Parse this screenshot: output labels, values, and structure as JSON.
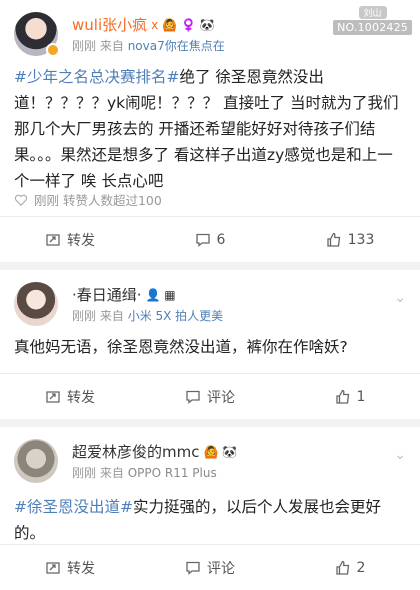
{
  "watermark": {
    "line1": "刘山",
    "line2": "NO.1002425"
  },
  "posts": [
    {
      "user": {
        "name": "wuli张小疯",
        "suffix": "x",
        "badges": "🙆 ♀️ 🐼"
      },
      "meta": {
        "time": "刚刚",
        "source_prefix": "来自",
        "source": "nova7你在焦点在"
      },
      "tag": "#少年之名总决赛排名#",
      "body": "绝了 徐圣恩竟然没出道！？？？？yk闹呢！？？？ 直接吐了 当时就为了我们那几个大厂男孩去的 开播还希望能好好对待孩子们结果。。。果然还是想多了 看这样子出道zy感觉也是和上一个一样了 唉 长点心吧",
      "stats": "刚刚 转赞人数超过100",
      "actions": {
        "repost": "转发",
        "comment": "6",
        "like": "133"
      }
    },
    {
      "user": {
        "name": "·春日通缉·",
        "badges": "👤 ▦"
      },
      "meta": {
        "time": "刚刚",
        "source_prefix": "来自",
        "source": "小米 5X 拍人更美"
      },
      "body": "真他妈无语，徐圣恩竟然没出道，裤你在作啥妖?",
      "actions": {
        "repost": "转发",
        "comment": "评论",
        "like": "1"
      }
    },
    {
      "user": {
        "name": "超爱林彦俊的mmc",
        "badges": "🙆 🐼"
      },
      "meta": {
        "time": "刚刚",
        "source_prefix": "来自",
        "source": "OPPO R11 Plus"
      },
      "tag": "#徐圣恩没出道#",
      "body": "实力挺强的，以后个人发展也会更好的。",
      "actions": {
        "repost": "转发",
        "comment": "评论",
        "like": "2"
      }
    }
  ]
}
